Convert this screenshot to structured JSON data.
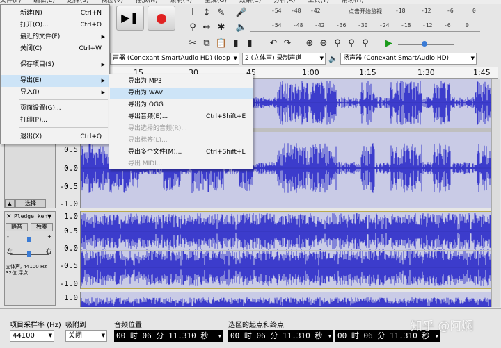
{
  "menubar": [
    "文件(F)",
    "编辑(E)",
    "选择(S)",
    "视图(V)",
    "播放(N)",
    "录制(R)",
    "生成(G)",
    "效果(C)",
    "分析(A)",
    "工具(T)",
    "帮助(H)"
  ],
  "meters": {
    "record_scale": [
      "-54",
      "-48",
      "-42",
      "点击开始监视",
      "-18",
      "-12",
      "-6",
      "0"
    ],
    "play_scale": [
      "-54",
      "-48",
      "-42",
      "-36",
      "-30",
      "-24",
      "-18",
      "-12",
      "-6",
      "0"
    ]
  },
  "device_toolbar": {
    "record_device": "声器 (Conexant SmartAudio HD) (loop",
    "channels": "2 (立体声) 录制声道",
    "playback_device": "扬声器 (Conexant SmartAudio HD)"
  },
  "timeline": {
    "ticks": [
      "15",
      "30",
      "45",
      "1:00",
      "1:15",
      "1:30",
      "1:45"
    ]
  },
  "file_menu": {
    "items": [
      {
        "label": "新建(N)",
        "shortcut": "Ctrl+N"
      },
      {
        "label": "打开(O)...",
        "shortcut": "Ctrl+O"
      },
      {
        "label": "最近的文件(F)",
        "shortcut": ""
      },
      {
        "label": "关闭(C)",
        "shortcut": "Ctrl+W"
      },
      {
        "label": "保存项目(S)",
        "shortcut": ""
      },
      {
        "label": "导出(E)",
        "shortcut": ""
      },
      {
        "label": "导入(I)",
        "shortcut": ""
      },
      {
        "label": "页面设置(G)...",
        "shortcut": ""
      },
      {
        "label": "打印(P)...",
        "shortcut": ""
      },
      {
        "label": "退出(X)",
        "shortcut": "Ctrl+Q"
      }
    ]
  },
  "export_submenu": {
    "items": [
      {
        "label": "导出为 MP3",
        "shortcut": ""
      },
      {
        "label": "导出为 WAV",
        "shortcut": ""
      },
      {
        "label": "导出为 OGG",
        "shortcut": ""
      },
      {
        "label": "导出音频(E)...",
        "shortcut": "Ctrl+Shift+E"
      },
      {
        "label": "导出选择的音频(R)...",
        "shortcut": ""
      },
      {
        "label": "导出标签(L)...",
        "shortcut": ""
      },
      {
        "label": "导出多个文件(M)...",
        "shortcut": "Ctrl+Shift+L"
      },
      {
        "label": "导出 MIDI...",
        "shortcut": ""
      }
    ]
  },
  "track1": {
    "axis": [
      "0.5",
      "0.0",
      "-0.5",
      "-1.0"
    ],
    "select_label": "选择",
    "collapse_icon": "triangle-up-icon"
  },
  "track2": {
    "name": "Pledge ken",
    "mute": "静音",
    "solo": "独奏",
    "info": "立体声, 44100 Hz\n32位 浮点",
    "axis": [
      "1.0",
      "0.5",
      "0.0",
      "-0.5",
      "-1.0"
    ],
    "gain_minus": "-",
    "gain_plus": "+",
    "pan_left": "左",
    "pan_right": "右"
  },
  "track3": {
    "axis": [
      "1.0"
    ]
  },
  "bottom": {
    "rate_label": "项目采样率 (Hz)",
    "rate_value": "44100",
    "snap_label": "吸附到",
    "snap_value": "关闭",
    "pos_label": "音频位置",
    "pos_value": "00 时 06 分 11.310 秒",
    "sel_label": "选区的起点和终点",
    "sel_start": "00 时 06 分 11.310 秒",
    "sel_end": "00 时 06 分 11.310 秒"
  },
  "watermark": "知乎 @阿焖",
  "colors": {
    "wave": "#3c3ccc",
    "wave_bg": "#c9cbe6",
    "highlight": "#cde4f7"
  }
}
